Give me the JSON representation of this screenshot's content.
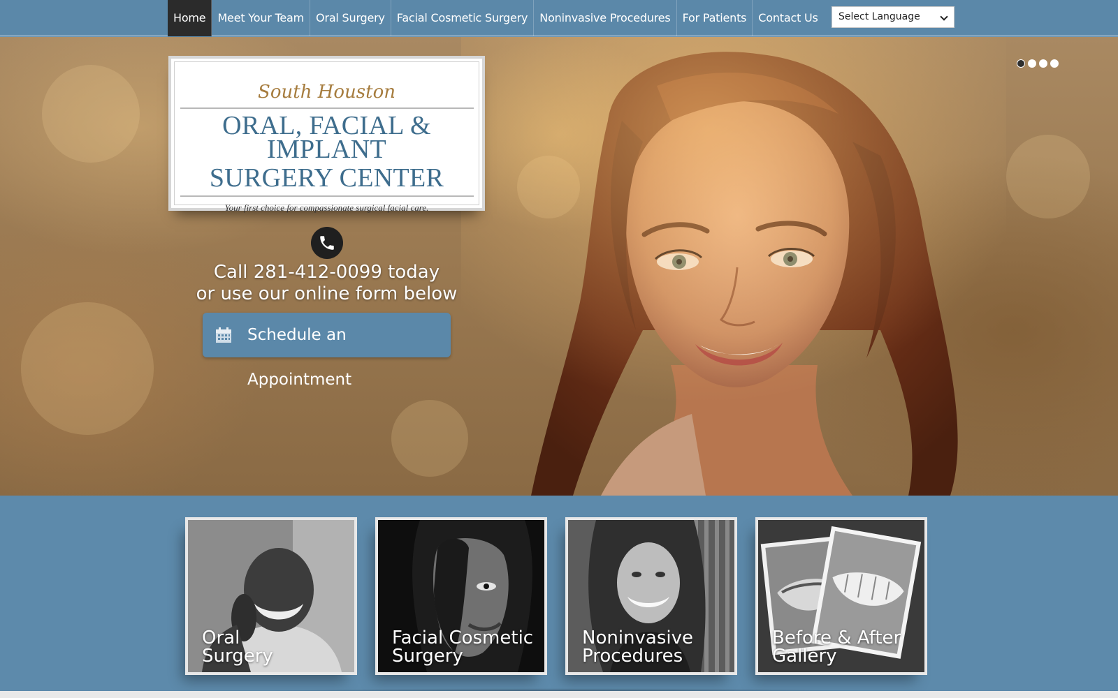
{
  "nav": {
    "items": [
      {
        "label": "Home",
        "active": true
      },
      {
        "label": "Meet Your Team",
        "active": false
      },
      {
        "label": "Oral Surgery",
        "active": false
      },
      {
        "label": "Facial Cosmetic Surgery",
        "active": false
      },
      {
        "label": "Noninvasive Procedures",
        "active": false
      },
      {
        "label": "For Patients",
        "active": false
      },
      {
        "label": "Contact Us",
        "active": false
      }
    ],
    "language_select": "Select Language"
  },
  "hero": {
    "logo": {
      "script": "South Houston",
      "line1": "ORAL, FACIAL & IMPLANT",
      "line2": "SURGERY CENTER",
      "tagline": "Your first choice for compassionate surgical facial care."
    },
    "call_line1": "Call 281-412-0099 today",
    "call_line2": "or use our online form below",
    "appointment_button": "Schedule an Appointment",
    "slider_count": 4,
    "slider_active": 1
  },
  "tiles": [
    {
      "line1": "Oral",
      "line2": "Surgery"
    },
    {
      "line1": "Facial Cosmetic",
      "line2": "Surgery"
    },
    {
      "line1": "Noninvasive",
      "line2": "Procedures"
    },
    {
      "line1": "Before & After",
      "line2": "Gallery"
    }
  ],
  "colors": {
    "nav_bg": "#5b88a9",
    "nav_active_bg": "#2b2b2b",
    "logo_blue": "#3e6d8d",
    "logo_gold": "#a67c3e"
  }
}
